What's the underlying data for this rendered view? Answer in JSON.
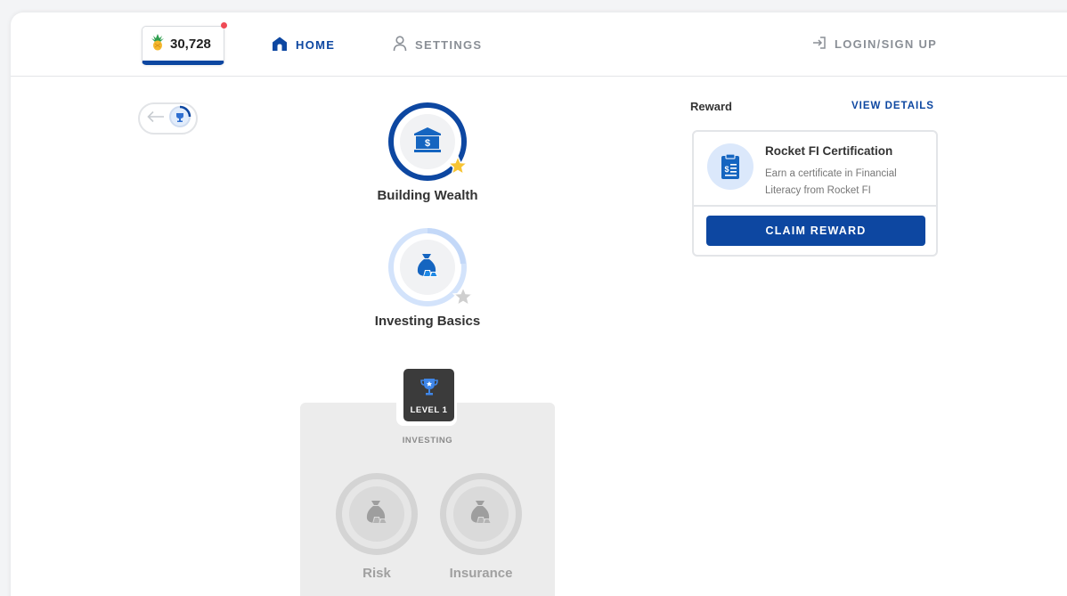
{
  "header": {
    "points": "30,728",
    "nav": {
      "home": "HOME",
      "settings": "SETTINGS",
      "login": "LOGIN/SIGN UP"
    }
  },
  "path": {
    "units": [
      {
        "title": "Building Wealth",
        "icon": "bank-icon",
        "status": "completed",
        "progress": 1.0
      },
      {
        "title": "Investing Basics",
        "icon": "money-bag-icon",
        "status": "in-progress",
        "progress": 0.3
      }
    ],
    "level": {
      "badge": "LEVEL 1",
      "name": "INVESTING",
      "units": [
        {
          "title": "Risk",
          "icon": "money-bag-icon",
          "status": "locked"
        },
        {
          "title": "Insurance",
          "icon": "money-bag-icon",
          "status": "locked"
        }
      ]
    }
  },
  "reward": {
    "label": "Reward",
    "view_details": "VIEW DETAILS",
    "title": "Rocket FI Certification",
    "description": "Earn a certificate in Financial Literacy from Rocket FI",
    "claim": "CLAIM REWARD"
  },
  "colors": {
    "brand": "#0d47a1",
    "notification": "#ef4a55",
    "star": "#f7c433"
  }
}
